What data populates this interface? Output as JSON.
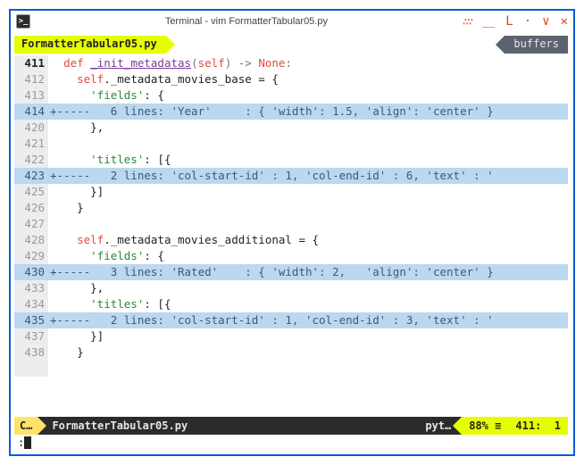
{
  "window": {
    "title": "Terminal - vim FormatterTabular05.py"
  },
  "tabs": {
    "active": "FormatterTabular05.py",
    "right": "buffers"
  },
  "code": {
    "lines": [
      {
        "n": "411",
        "type": "normal",
        "tokens": [
          {
            "t": "  ",
            "c": ""
          },
          {
            "t": "def",
            "c": "kw"
          },
          {
            "t": " ",
            "c": ""
          },
          {
            "t": "_init_metadatas",
            "c": "fn"
          },
          {
            "t": "(",
            "c": "punc"
          },
          {
            "t": "self",
            "c": "self"
          },
          {
            "t": ") -> ",
            "c": "punc"
          },
          {
            "t": "None",
            "c": "self"
          },
          {
            "t": ":",
            "c": "punc"
          }
        ]
      },
      {
        "n": "412",
        "type": "normal",
        "tokens": [
          {
            "t": "    ",
            "c": ""
          },
          {
            "t": "self",
            "c": "self"
          },
          {
            "t": "._metadata_movies_base = {",
            "c": "ident"
          }
        ]
      },
      {
        "n": "413",
        "type": "normal",
        "tokens": [
          {
            "t": "      ",
            "c": ""
          },
          {
            "t": "'fields'",
            "c": "str"
          },
          {
            "t": ": {",
            "c": "ident"
          }
        ]
      },
      {
        "n": "414",
        "type": "fold",
        "text": "+-----   6 lines: 'Year'     : { 'width': 1.5, 'align': 'center' }"
      },
      {
        "n": "420",
        "type": "normal",
        "tokens": [
          {
            "t": "      },",
            "c": "ident"
          }
        ]
      },
      {
        "n": "421",
        "type": "normal",
        "tokens": [
          {
            "t": " ",
            "c": ""
          }
        ]
      },
      {
        "n": "422",
        "type": "normal",
        "tokens": [
          {
            "t": "      ",
            "c": ""
          },
          {
            "t": "'titles'",
            "c": "str"
          },
          {
            "t": ": [{",
            "c": "ident"
          }
        ]
      },
      {
        "n": "423",
        "type": "fold",
        "text": "+-----   2 lines: 'col-start-id' : 1, 'col-end-id' : 6, 'text' : '"
      },
      {
        "n": "425",
        "type": "normal",
        "tokens": [
          {
            "t": "      }]",
            "c": "ident"
          }
        ]
      },
      {
        "n": "426",
        "type": "normal",
        "tokens": [
          {
            "t": "    }",
            "c": "ident"
          }
        ]
      },
      {
        "n": "427",
        "type": "normal",
        "tokens": [
          {
            "t": " ",
            "c": ""
          }
        ]
      },
      {
        "n": "428",
        "type": "normal",
        "tokens": [
          {
            "t": "    ",
            "c": ""
          },
          {
            "t": "self",
            "c": "self"
          },
          {
            "t": "._metadata_movies_additional = {",
            "c": "ident"
          }
        ]
      },
      {
        "n": "429",
        "type": "normal",
        "tokens": [
          {
            "t": "      ",
            "c": ""
          },
          {
            "t": "'fields'",
            "c": "str"
          },
          {
            "t": ": {",
            "c": "ident"
          }
        ]
      },
      {
        "n": "430",
        "type": "fold",
        "text": "+-----   3 lines: 'Rated'    : { 'width': 2,   'align': 'center' }"
      },
      {
        "n": "433",
        "type": "normal",
        "tokens": [
          {
            "t": "      },",
            "c": "ident"
          }
        ]
      },
      {
        "n": "434",
        "type": "normal",
        "tokens": [
          {
            "t": "      ",
            "c": ""
          },
          {
            "t": "'titles'",
            "c": "str"
          },
          {
            "t": ": [{",
            "c": "ident"
          }
        ]
      },
      {
        "n": "435",
        "type": "fold",
        "text": "+-----   2 lines: 'col-start-id' : 1, 'col-end-id' : 3, 'text' : '"
      },
      {
        "n": "437",
        "type": "normal",
        "tokens": [
          {
            "t": "      }]",
            "c": "ident"
          }
        ]
      },
      {
        "n": "438",
        "type": "normal",
        "tokens": [
          {
            "t": "    }",
            "c": "ident"
          }
        ]
      },
      {
        "n": "   ",
        "type": "normal",
        "tokens": [
          {
            "t": " ",
            "c": ""
          }
        ]
      }
    ],
    "current_line": "411"
  },
  "status": {
    "mode": "C…",
    "file": "FormatterTabular05.py",
    "filetype": "pyt…",
    "percent": "88%",
    "sep": "≡",
    "line": "411",
    "col": "1"
  },
  "cmdline": {
    "prompt": ":"
  }
}
